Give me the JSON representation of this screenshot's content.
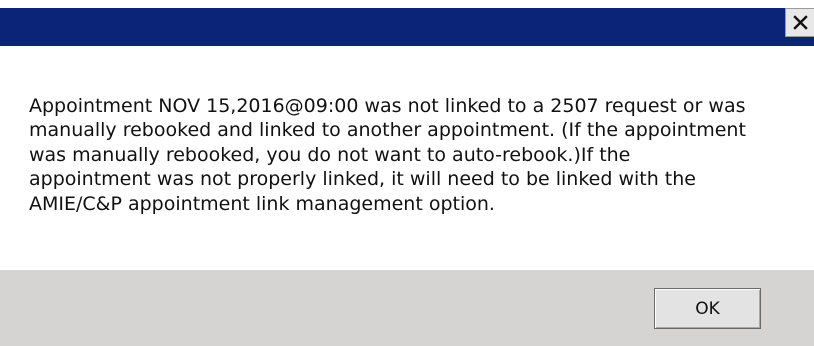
{
  "titlebar": {
    "color": "#0b2478",
    "close_icon": "close-icon"
  },
  "message": {
    "lines": [
      "Appointment NOV 15,2016@09:00 was not linked to a 2507 request or was",
      "manually rebooked and linked to another appointment. (If the appointment",
      "was manually rebooked, you do not want to auto-rebook.)If the",
      "appointment was not properly linked, it will need to be linked with the",
      "AMIE/C&P appointment link management option."
    ]
  },
  "footer": {
    "ok_label": "OK",
    "background": "#d6d3d3"
  }
}
